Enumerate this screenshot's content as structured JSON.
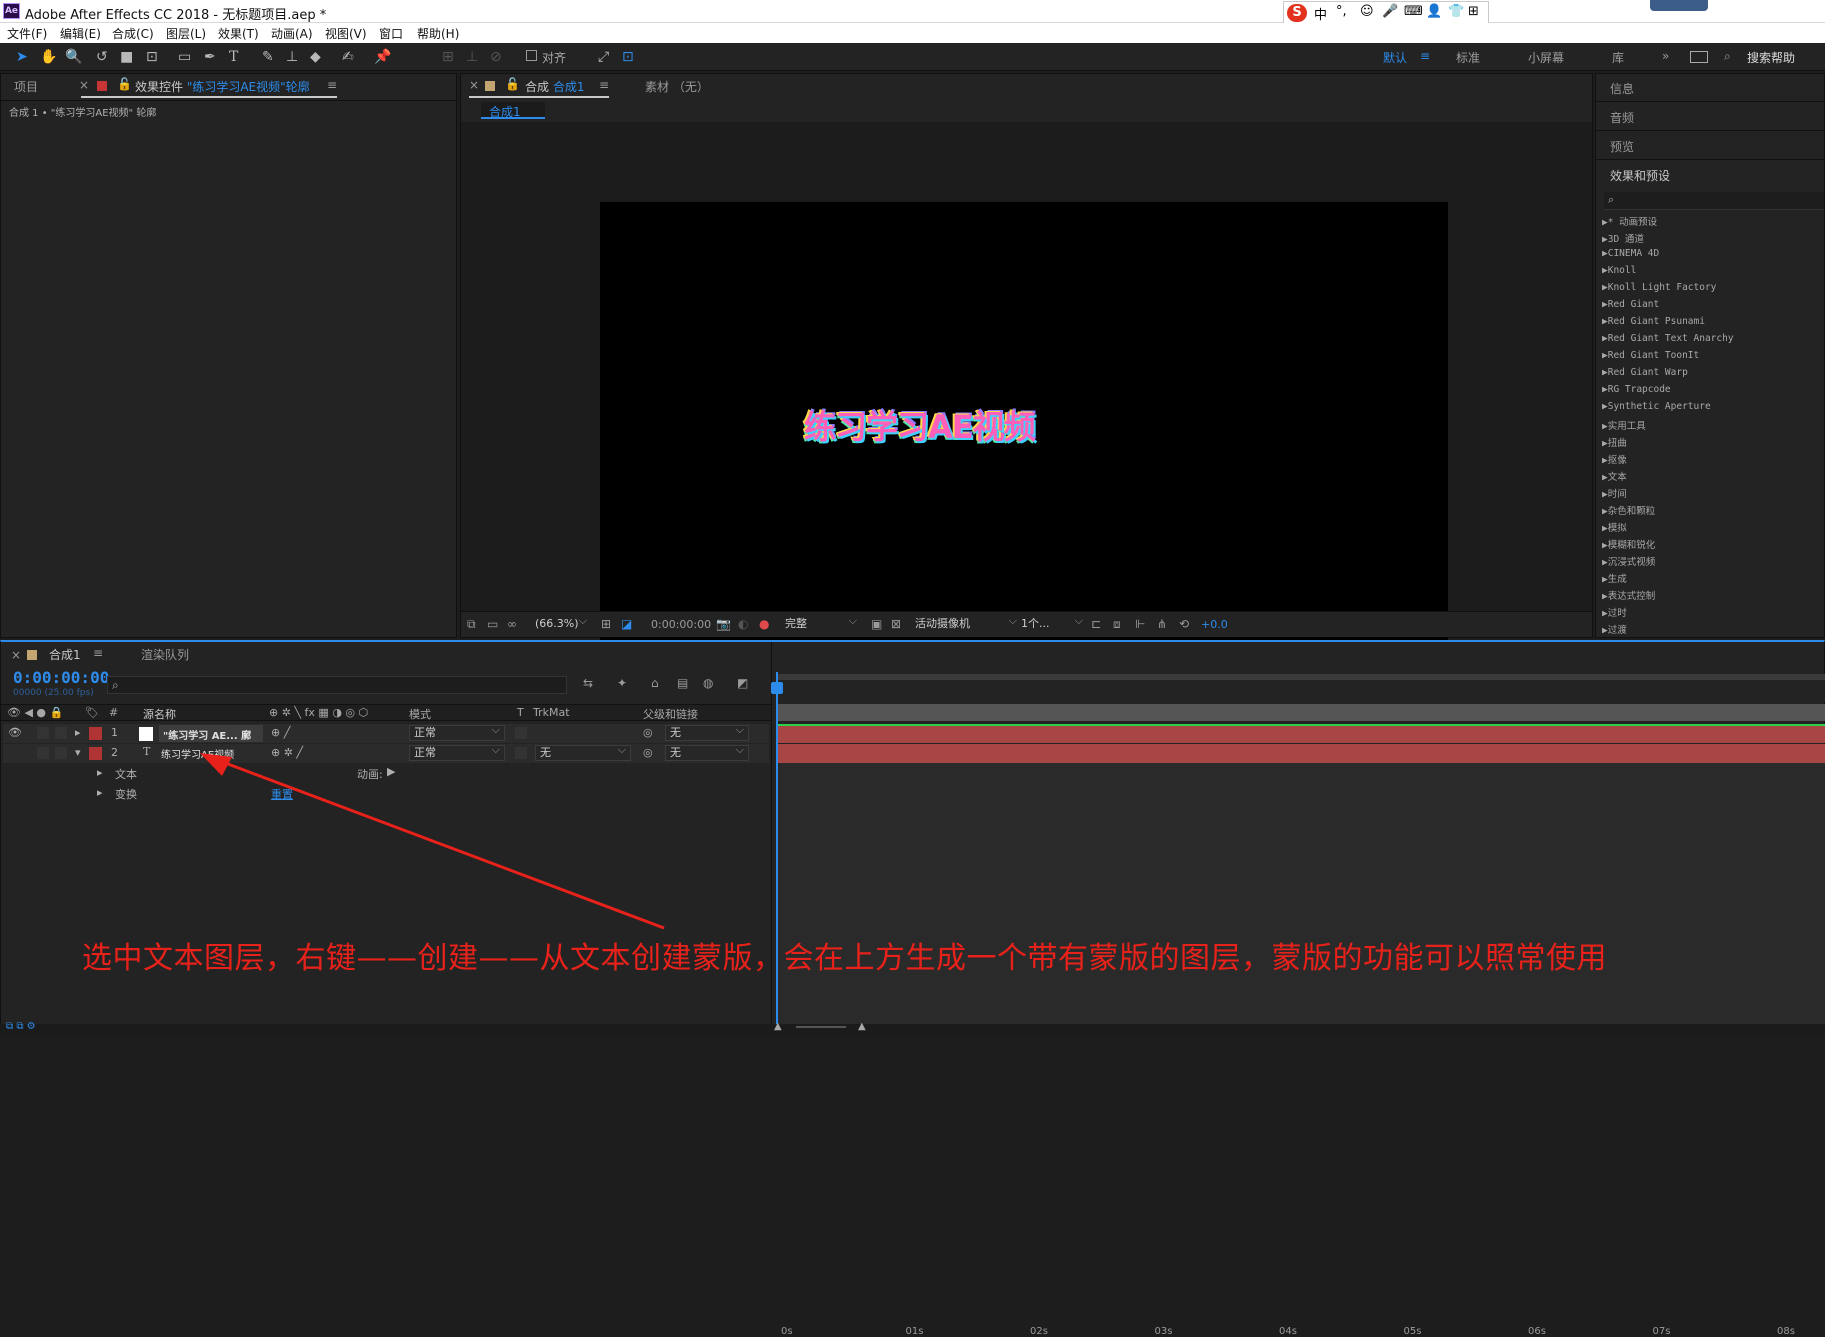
{
  "window": {
    "title": "Adobe After Effects CC 2018 - 无标题项目.aep *",
    "logo": "Ae"
  },
  "ime": {
    "items": [
      "中",
      "°,",
      "☺",
      "🎤",
      "⌨",
      "👤",
      "👕",
      "⊞"
    ]
  },
  "menu": [
    "文件(F)",
    "编辑(E)",
    "合成(C)",
    "图层(L)",
    "效果(T)",
    "动画(A)",
    "视图(V)",
    "窗口",
    "帮助(H)"
  ],
  "toolbar": {
    "align_label": "对齐",
    "workspaces": [
      "默认",
      "标准",
      "小屏幕",
      "库"
    ],
    "search_placeholder": "搜索帮助"
  },
  "project_panel": {
    "tab_project": "项目",
    "tab_effects": "效果控件 ",
    "tab_effects_layer": "\"练习学习AE视频\"轮廓",
    "subtitle": "合成 1 • \"练习学习AE视频\" 轮廓"
  },
  "comp_panel": {
    "tab_comp": "合成 ",
    "tab_comp_name": "合成1",
    "tab_footage": "素材 （无）",
    "breadcrumb": "合成1",
    "canvas_text": "练习学习AE视频",
    "zoom": "(66.3%)",
    "time": "0:00:00:00",
    "resolution": "完整",
    "camera": "活动摄像机",
    "views": "1个...",
    "exposure": "+0.0"
  },
  "right_panel": {
    "sections": [
      "信息",
      "音频",
      "预览",
      "效果和预设"
    ],
    "effects": [
      "* 动画预设",
      "3D 通道",
      "CINEMA 4D",
      "Knoll",
      "Knoll Light Factory",
      "Red Giant",
      "Red Giant Psunami",
      "Red Giant Text Anarchy",
      "Red Giant ToonIt",
      "Red Giant Warp",
      "RG Trapcode",
      "Synthetic Aperture",
      "实用工具",
      "扭曲",
      "抠像",
      "文本",
      "时间",
      "杂色和颗粒",
      "模拟",
      "模糊和锐化",
      "沉浸式视频",
      "生成",
      "表达式控制",
      "过时",
      "过渡"
    ]
  },
  "timeline": {
    "tab_comp": "合成1",
    "tab_render": "渲染队列",
    "timecode": "0:00:00:00",
    "fps": "00000 (25.00 fps)",
    "headers": {
      "num": "#",
      "name": "源名称",
      "mode": "模式",
      "t": "T",
      "trkmat": "TrkMat",
      "parent": "父级和链接"
    },
    "layers": [
      {
        "num": "1",
        "name": "\"练习学习 AE... 廓",
        "mode": "正常",
        "trkmat": "",
        "parent": "无"
      },
      {
        "num": "2",
        "name": "练习学习AE视频",
        "mode": "正常",
        "trkmat": "无",
        "parent": "无"
      }
    ],
    "sub_rows": [
      {
        "label": "文本",
        "right": "动画:"
      },
      {
        "label": "变换",
        "right": "重置"
      }
    ],
    "ruler": [
      "0s",
      "01s",
      "02s",
      "03s",
      "04s",
      "05s",
      "06s",
      "07s",
      "08s"
    ]
  },
  "annotation": "选中文本图层，右键——创建——从文本创建蒙版，会在上方生成一个带有蒙版的图层，蒙版的功能可以照常使用",
  "colors": {
    "accent": "#2d8ceb",
    "label_red": "#b13434",
    "annotation": "#e8221a",
    "bar_red": "#a84545"
  }
}
